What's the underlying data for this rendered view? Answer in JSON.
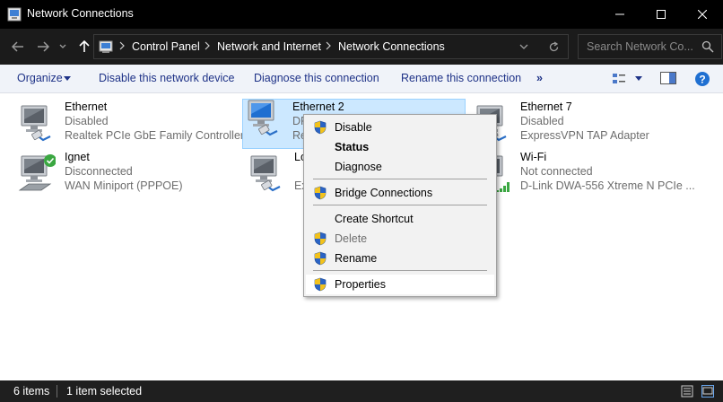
{
  "window": {
    "title": "Network Connections",
    "icons": {
      "app": "network-connections-icon",
      "minimize": "minimize-icon",
      "maximize": "maximize-icon",
      "close": "close-icon"
    }
  },
  "addressbar": {
    "breadcrumbs": [
      "Control Panel",
      "Network and Internet",
      "Network Connections"
    ],
    "search_placeholder": "Search Network Co...",
    "icons": {
      "back": "back-arrow-icon",
      "forward": "forward-arrow-icon",
      "recent": "chevron-down-icon",
      "up": "up-arrow-icon",
      "location": "control-panel-icon",
      "dropdown": "chevron-down-icon",
      "refresh": "refresh-icon",
      "search": "search-icon"
    }
  },
  "commandbar": {
    "organize": "Organize",
    "disable": "Disable this network device",
    "diagnose": "Diagnose this connection",
    "rename": "Rename this connection",
    "more": "»",
    "icons": {
      "view": "change-view-icon",
      "preview": "preview-pane-icon",
      "help": "help-icon"
    }
  },
  "connections": [
    {
      "name": "Ethernet",
      "status": "Disabled",
      "device": "Realtek PCIe GbE Family Controller",
      "icon": "ethernet-adapter-icon",
      "selected": false
    },
    {
      "name": "Ethernet 2",
      "status": "DF",
      "device": "Re",
      "icon": "ethernet-adapter-icon",
      "selected": true
    },
    {
      "name": "Ethernet 7",
      "status": "Disabled",
      "device": "ExpressVPN TAP Adapter",
      "icon": "ethernet-adapter-icon",
      "selected": false
    },
    {
      "name": "Ignet",
      "status": "Disconnected",
      "device": "WAN Miniport (PPPOE)",
      "icon": "broadband-connection-icon",
      "selected": false
    },
    {
      "name": "Lo",
      "status": "",
      "device": "Ex",
      "icon": "ethernet-adapter-icon",
      "selected": false
    },
    {
      "name": "Wi-Fi",
      "status": "Not connected",
      "device": "D-Link DWA-556 Xtreme N PCIe ...",
      "icon": "wifi-adapter-icon",
      "selected": false
    }
  ],
  "context_menu": {
    "items": [
      {
        "label": "Disable",
        "shield": true
      },
      {
        "label": "Status",
        "shield": false,
        "bold": true
      },
      {
        "label": "Diagnose",
        "shield": false
      },
      {
        "label": "Bridge Connections",
        "shield": true
      },
      {
        "label": "Create Shortcut",
        "shield": false
      },
      {
        "label": "Delete",
        "shield": true,
        "disabled": true
      },
      {
        "label": "Rename",
        "shield": true
      },
      {
        "label": "Properties",
        "shield": true,
        "highlighted": true
      }
    ]
  },
  "statusbar": {
    "count": "6 items",
    "selection": "1 item selected",
    "icons": {
      "details_view": "details-view-icon",
      "large_icons_view": "large-icons-view-icon"
    }
  },
  "colors": {
    "titlebar": "#000000",
    "addressbar": "#1b1b1b",
    "commandbar": "#f0f3f9",
    "command_text": "#1e3287",
    "selection": "#cce8ff",
    "secondary_text": "#6d6d6d",
    "shield_blue": "#2b64c5",
    "shield_yellow": "#f3c21b",
    "status_ok": "#3aa741"
  }
}
